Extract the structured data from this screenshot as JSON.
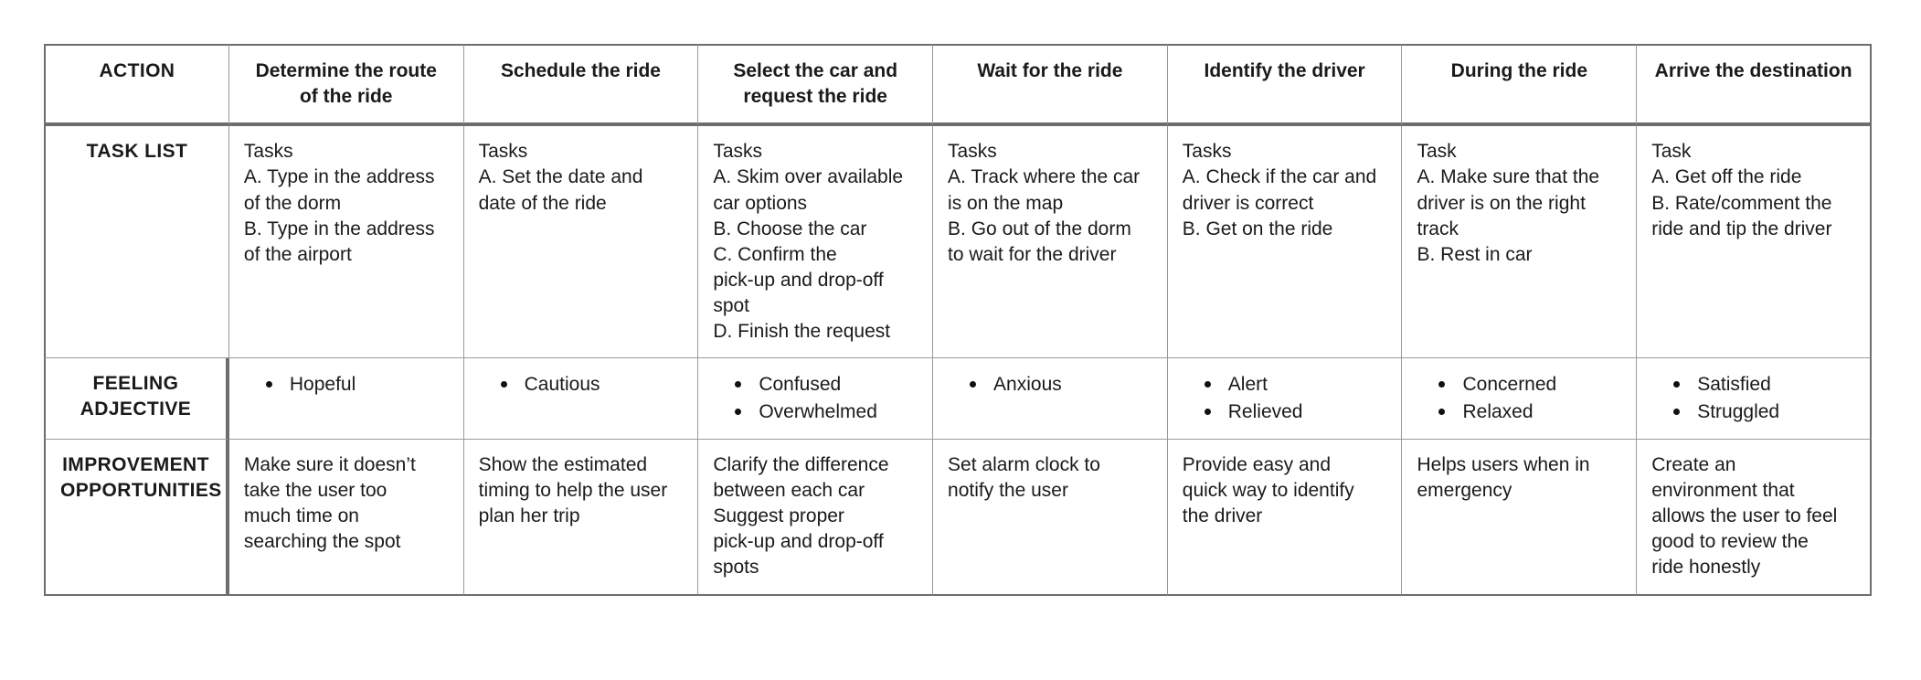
{
  "table": {
    "row_labels": {
      "action": "ACTION",
      "task_list": "TASK LIST",
      "feeling_adjective_line1": "FEELING",
      "feeling_adjective_line2": "ADJECTIVE",
      "improvement_line1": "IMPROVEMENT",
      "improvement_line2": "OPPORTUNITIES"
    },
    "colors": {
      "header_fill": "#d8e2f0",
      "label_fill": "#f2f2f2",
      "frame_border": "#6d6d6d",
      "inner_border": "#9a9a9a",
      "text": "#111111"
    },
    "columns": [
      {
        "header_lines": [
          "Determine the route",
          "of the ride"
        ],
        "tasks_heading": "Tasks",
        "tasks": [
          "A. Type in the  address",
          "of the dorm",
          "B. Type in the  address",
          "of the airport"
        ],
        "feelings": [
          "Hopeful"
        ],
        "improvements": [
          "Make sure it doesn’t",
          "take the user too",
          "much time on",
          "searching the spot"
        ]
      },
      {
        "header_lines": [
          "Schedule the ride"
        ],
        "tasks_heading": "Tasks",
        "tasks": [
          "A. Set the date and",
          "date of the ride"
        ],
        "feelings": [
          "Cautious"
        ],
        "improvements": [
          "Show the estimated",
          "timing to help the user",
          "plan her trip"
        ]
      },
      {
        "header_lines": [
          "Select the car and",
          "request the ride"
        ],
        "tasks_heading": "Tasks",
        "tasks": [
          "A. Skim over available",
          "car options",
          "B. Choose the car",
          "C. Confirm the",
          "pick-up and drop-off",
          "spot",
          "D. Finish the request"
        ],
        "feelings": [
          "Confused",
          "Overwhelmed"
        ],
        "improvements": [
          "Clarify the difference",
          "between each car",
          "Suggest proper",
          "pick-up and drop-off",
          "spots"
        ]
      },
      {
        "header_lines": [
          "Wait for the ride"
        ],
        "tasks_heading": "Tasks",
        "tasks": [
          "A. Track where the car",
          "is on the map",
          "B. Go out of the dorm",
          "to wait for the driver"
        ],
        "feelings": [
          "Anxious"
        ],
        "improvements": [
          "Set alarm clock to",
          "notify the user"
        ]
      },
      {
        "header_lines": [
          "Identify the driver"
        ],
        "tasks_heading": "Tasks",
        "tasks": [
          "A. Check if the car and",
          "driver is correct",
          "B.  Get on the ride"
        ],
        "feelings": [
          "Alert",
          "Relieved"
        ],
        "improvements": [
          "Provide easy and",
          "quick way to identify",
          "the driver"
        ]
      },
      {
        "header_lines": [
          "During the ride"
        ],
        "tasks_heading": "Task",
        "tasks": [
          "A. Make sure that the",
          "driver is on the right",
          "track",
          "B. Rest in car"
        ],
        "feelings": [
          "Concerned",
          "Relaxed"
        ],
        "improvements": [
          "Helps users when in",
          "emergency"
        ]
      },
      {
        "header_lines": [
          "Arrive the destination"
        ],
        "tasks_heading": "Task",
        "tasks": [
          "A. Get off the ride",
          "B. Rate/comment the",
          "ride and tip the driver"
        ],
        "feelings": [
          "Satisfied",
          "Struggled"
        ],
        "improvements": [
          "Create an",
          "environment that",
          "allows the user to feel",
          "good to review the",
          "ride honestly"
        ]
      }
    ]
  }
}
